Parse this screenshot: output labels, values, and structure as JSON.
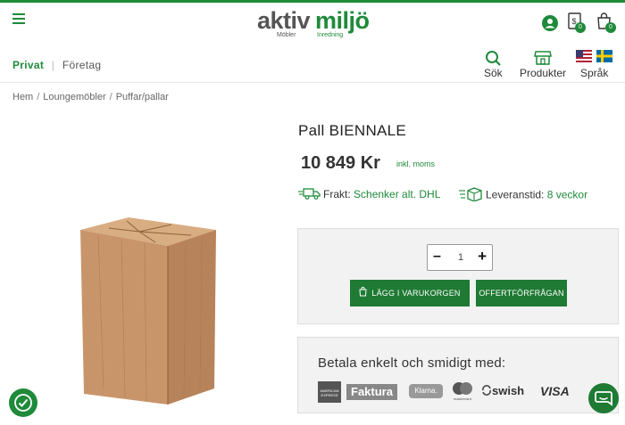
{
  "header": {
    "logo_word1": "aktiv",
    "logo_word2": "miljö",
    "logo_sub1": "Möbler",
    "logo_sub2": "Inredning",
    "cart_count": "0",
    "quote_count": "0"
  },
  "tabs": {
    "private": "Privat",
    "separator": "|",
    "business": "Företag"
  },
  "nav": {
    "search": "Sök",
    "products": "Produkter",
    "language": "Språk"
  },
  "breadcrumb": [
    "Hem",
    "Loungemöbler",
    "Puffar/pallar"
  ],
  "product": {
    "title": "Pall BIENNALE",
    "price": "10 849 Kr",
    "vat_note": "inkl. moms",
    "shipping_label": "Frakt:",
    "shipping_value": "Schenker alt. DHL",
    "lead_label": "Leveranstid:",
    "lead_value": "8 veckor",
    "quantity": "1",
    "add_to_cart": "LÄGG I VARUKORGEN",
    "quote_request": "OFFERTFÖRFRÅGAN"
  },
  "payment": {
    "title": "Betala enkelt och smidigt med:",
    "amex": "AMERICAN EXPRESS",
    "faktura": "Faktura",
    "klarna": "Klarna.",
    "mastercard": "mastercard",
    "swish": "swish",
    "visa": "VISA"
  },
  "colors": {
    "brand_green": "#1f8a3a",
    "button_green": "#1f7a34"
  }
}
